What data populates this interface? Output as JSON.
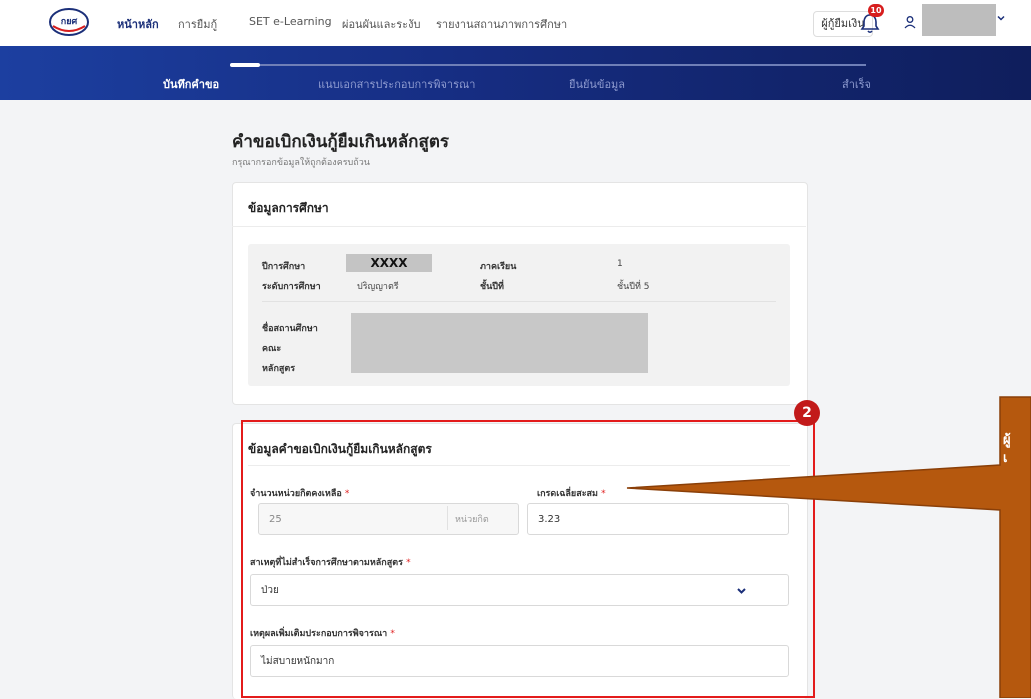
{
  "nav": {
    "items": [
      "หน้าหลัก",
      "การยืมกู้",
      "SET e-Learning",
      "ผ่อนผันและระงับ",
      "รายงานสถานภาพการศึกษา"
    ],
    "lender_button": "ผู้กู้ยืมเงิน",
    "notification_count": "10"
  },
  "steps": [
    "บันทึกคำขอ",
    "แนบเอกสารประกอบการพิจารณา",
    "ยืนยันข้อมูล",
    "สำเร็จ"
  ],
  "page": {
    "title": "คำขอเบิกเงินกู้ยืมเกินหลักสูตร",
    "subtitle": "กรุณากรอกข้อมูลให้ถูกต้องครบถ้วน"
  },
  "education": {
    "section_title": "ข้อมูลการศึกษา",
    "academic_year_label": "ปีการศึกษา",
    "academic_year_value": "XXXX",
    "level_label": "ระดับการศึกษา",
    "level_value": "ปริญญาตรี",
    "semester_label": "ภาคเรียน",
    "semester_value": "1",
    "grade_label": "ชั้นปีที่",
    "grade_value": "ชั้นปีที่ 5",
    "institution_label": "ชื่อสถานศึกษา",
    "faculty_label": "คณะ",
    "program_label": "หลักสูตร"
  },
  "request": {
    "section_title": "ข้อมูลคำขอเบิกเงินกู้ยืมเกินหลักสูตร",
    "credits_label": "จำนวนหน่วยกิตคงเหลือ",
    "credits_value": "25",
    "credits_unit": "หน่วยกิต",
    "gpa_label": "เกรดเฉลี่ยสะสม",
    "gpa_value": "3.23",
    "reason_label": "สาเหตุที่ไม่สำเร็จการศึกษาตามหลักสูตร",
    "reason_value": "ป่วย",
    "extra_label": "เหตุผลเพิ่มเติมประกอบการพิจารณา",
    "extra_value": "ไม่สบายหนักมาก",
    "required_mark": "*"
  },
  "annotation": {
    "marker_number": "2",
    "callout_text": "ผู้\nเ"
  },
  "colors": {
    "primary": "#1b2f79",
    "highlight": "#e31b1b",
    "callout": "#b5580e"
  }
}
